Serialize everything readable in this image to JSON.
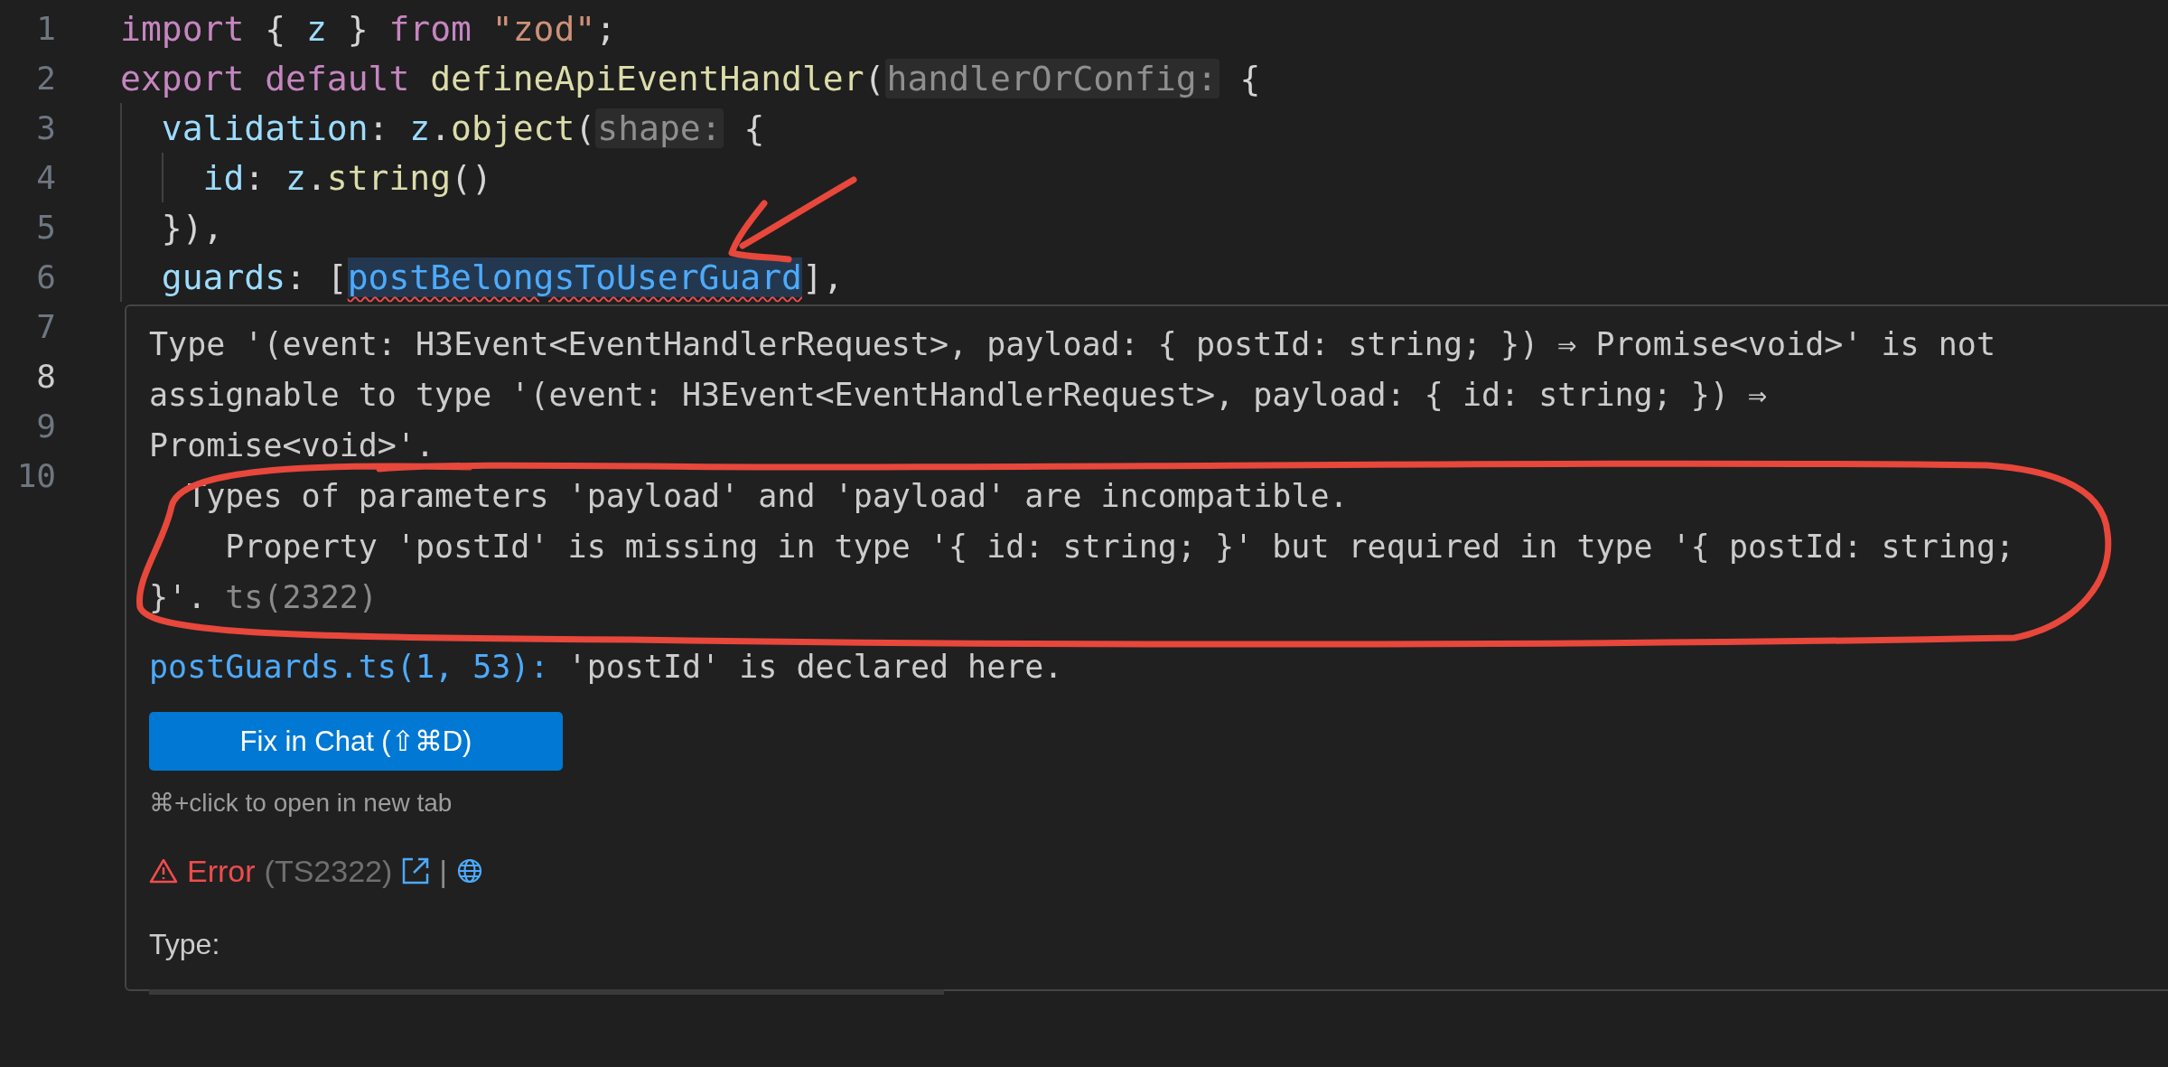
{
  "editor": {
    "lines": [
      {
        "number": "1",
        "current": false,
        "tokens": [
          {
            "text": "import ",
            "kind": "keyword"
          },
          {
            "text": "{ ",
            "kind": "punct"
          },
          {
            "text": "z",
            "kind": "var"
          },
          {
            "text": " } ",
            "kind": "punct"
          },
          {
            "text": "from ",
            "kind": "keyword"
          },
          {
            "text": "\"zod\"",
            "kind": "string"
          },
          {
            "text": ";",
            "kind": "punct"
          }
        ]
      },
      {
        "number": "2",
        "current": false,
        "tokens": [
          {
            "text": "export default ",
            "kind": "keyword"
          },
          {
            "text": "defineApiEventHandler",
            "kind": "func"
          },
          {
            "text": "(",
            "kind": "punct"
          },
          {
            "text": "handlerOrConfig:",
            "kind": "hint"
          },
          {
            "text": " {",
            "kind": "punct"
          }
        ]
      },
      {
        "number": "3",
        "current": false,
        "tokens": [
          {
            "text": "  validation",
            "kind": "prop"
          },
          {
            "text": ": ",
            "kind": "punct"
          },
          {
            "text": "z",
            "kind": "var"
          },
          {
            "text": ".",
            "kind": "punct"
          },
          {
            "text": "object",
            "kind": "func"
          },
          {
            "text": "(",
            "kind": "punct"
          },
          {
            "text": "shape:",
            "kind": "hint"
          },
          {
            "text": " {",
            "kind": "punct"
          }
        ]
      },
      {
        "number": "4",
        "current": false,
        "tokens": [
          {
            "text": "    id",
            "kind": "prop"
          },
          {
            "text": ": ",
            "kind": "punct"
          },
          {
            "text": "z",
            "kind": "var"
          },
          {
            "text": ".",
            "kind": "punct"
          },
          {
            "text": "string",
            "kind": "func"
          },
          {
            "text": "()",
            "kind": "punct"
          }
        ]
      },
      {
        "number": "5",
        "current": false,
        "tokens": [
          {
            "text": "  }),",
            "kind": "punct"
          }
        ]
      },
      {
        "number": "6",
        "current": false,
        "tokens": [
          {
            "text": "  guards",
            "kind": "prop"
          },
          {
            "text": ": [",
            "kind": "punct"
          },
          {
            "text": "postBelongsToUserGuard",
            "kind": "error-ref"
          },
          {
            "text": "],",
            "kind": "punct"
          }
        ]
      },
      {
        "number": "7",
        "current": false
      },
      {
        "number": "8",
        "current": true
      },
      {
        "number": "9",
        "current": false
      },
      {
        "number": "10",
        "current": false
      }
    ]
  },
  "hover": {
    "message_lines": [
      [
        {
          "text": "Type '(event: H3Event<EventHandlerRequest>, payload: { postId: string; }) ⇒ Promise<void>' is not",
          "kind": "message"
        }
      ],
      [
        {
          "text": "assignable to type '(event: H3Event<EventHandlerRequest>, payload: { id: string; }) ⇒",
          "kind": "message"
        }
      ],
      [
        {
          "text": "Promise<void>'.",
          "kind": "message"
        }
      ],
      [
        {
          "text": "  Types of parameters 'payload' and 'payload' are incompatible.",
          "kind": "message"
        }
      ],
      [
        {
          "text": "    Property 'postId' is missing in type '{ id: string; }' but required in type '{ postId: string;",
          "kind": "message"
        }
      ],
      [
        {
          "text": "}'.",
          "kind": "message"
        },
        {
          "text": " ts(2322)",
          "kind": "source"
        }
      ]
    ],
    "related": {
      "link": "postGuards.ts(1, 53):",
      "text": " 'postId' is declared here."
    },
    "fix_button": "Fix in Chat (⇧⌘D)",
    "open_hint": "⌘+click to open in new tab",
    "severity": {
      "kind": "error",
      "label": "Error",
      "code": "(TS2322)",
      "separator": "|"
    },
    "section_label": "Type:"
  }
}
